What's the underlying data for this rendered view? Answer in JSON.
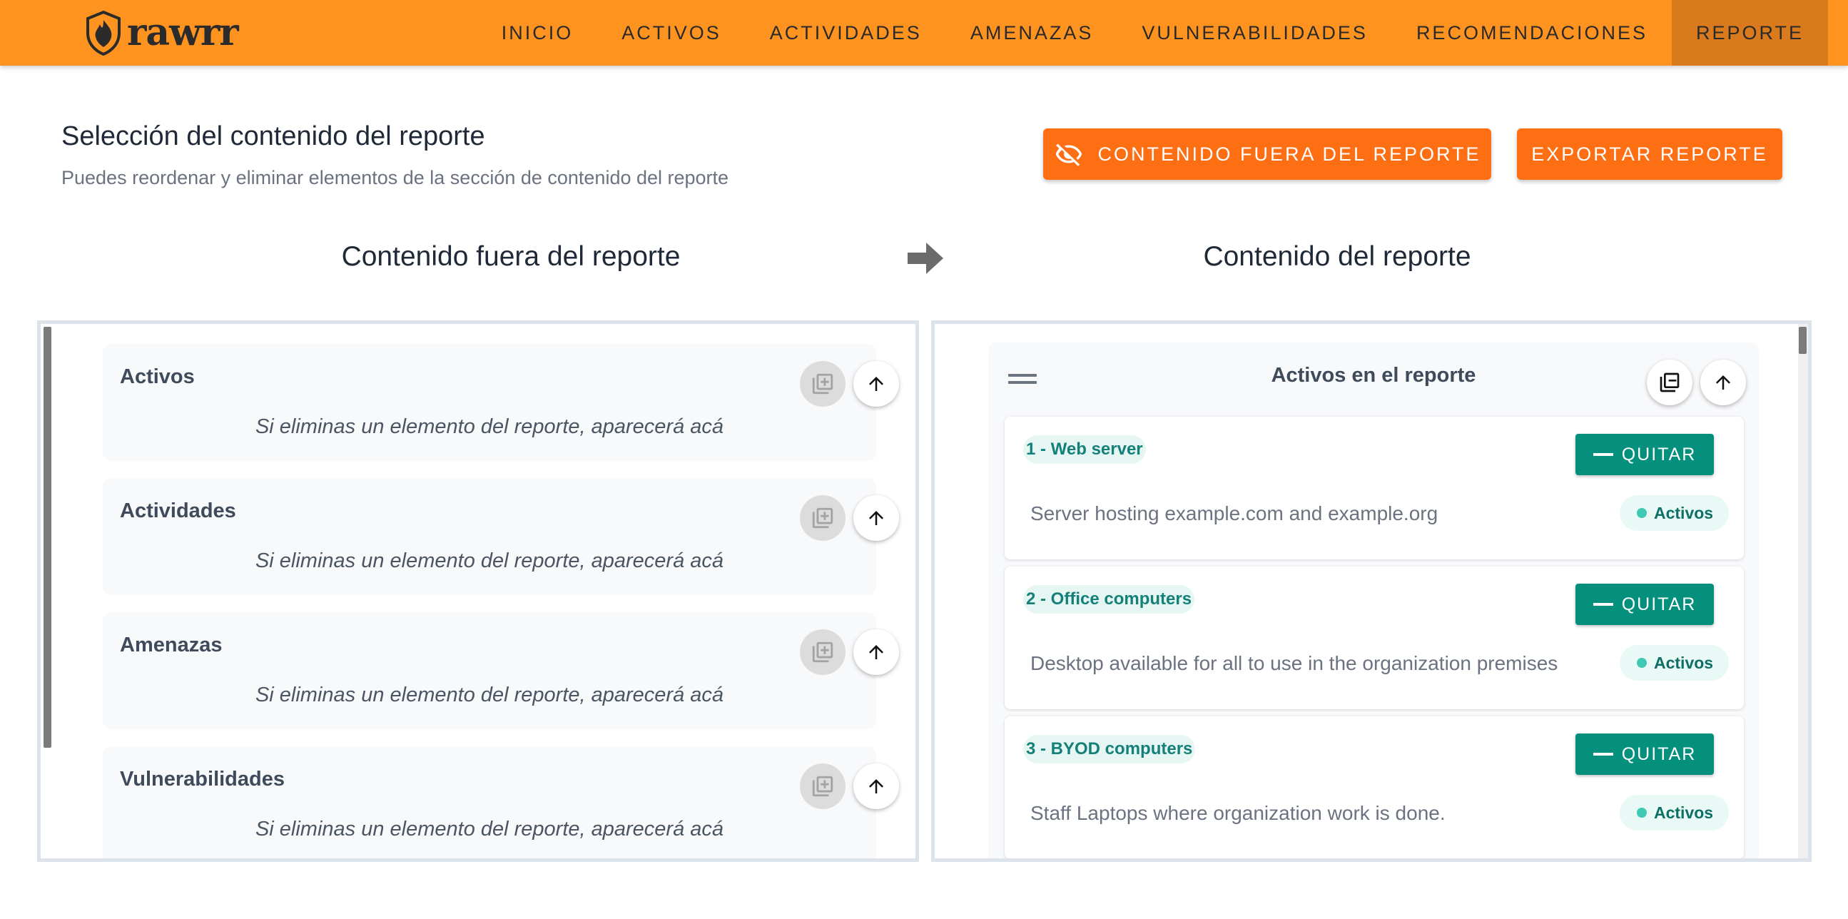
{
  "app": {
    "logo_text": "rawrr",
    "nav": [
      "INICIO",
      "ACTIVOS",
      "ACTIVIDADES",
      "AMENAZAS",
      "VULNERABILIDADES",
      "RECOMENDACIONES",
      "REPORTE"
    ],
    "active_nav": "REPORTE"
  },
  "header": {
    "title": "Selección del contenido del reporte",
    "subtitle": "Puedes reordenar y eliminar elementos de la sección de contenido del reporte",
    "btn_out_label": "CONTENIDO FUERA DEL REPORTE",
    "btn_export_label": "EXPORTAR REPORTE"
  },
  "left": {
    "heading": "Contenido fuera del reporte",
    "sections": [
      {
        "name": "Activos",
        "empty": "Si eliminas un elemento del reporte, aparecerá acá"
      },
      {
        "name": "Actividades",
        "empty": "Si eliminas un elemento del reporte, aparecerá acá"
      },
      {
        "name": "Amenazas",
        "empty": "Si eliminas un elemento del reporte, aparecerá acá"
      },
      {
        "name": "Vulnerabilidades",
        "empty": "Si eliminas un elemento del reporte, aparecerá acá"
      }
    ]
  },
  "right": {
    "heading": "Contenido del reporte",
    "section_title": "Activos en el reporte",
    "remove_label": "QUITAR",
    "items": [
      {
        "name": "1 - Web server",
        "description": "Server hosting example.com and example.org",
        "tag": "Activos"
      },
      {
        "name": "2 - Office computers",
        "description": "Desktop available for all to use in the organization premises",
        "tag": "Activos"
      },
      {
        "name": "3 - BYOD computers",
        "description": "Staff Laptops where organization work is done.",
        "tag": "Activos"
      }
    ]
  },
  "colors": {
    "nav_bg": "#fe9320",
    "nav_active": "#d97a1c",
    "button_orange": "#fe6f14",
    "button_teal": "#05907e"
  }
}
